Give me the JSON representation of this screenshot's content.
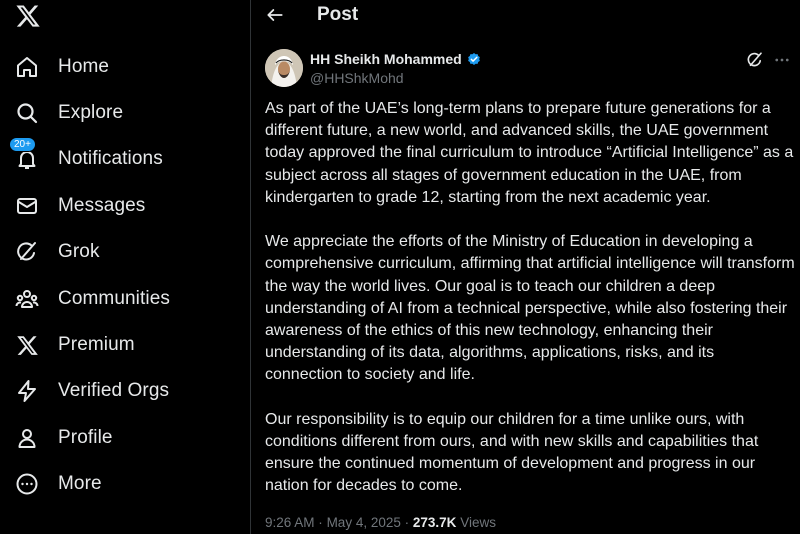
{
  "sidebar": {
    "logo": "x-logo-icon",
    "items": [
      {
        "label": "Home",
        "icon": "home-icon"
      },
      {
        "label": "Explore",
        "icon": "search-icon"
      },
      {
        "label": "Notifications",
        "icon": "bell-icon",
        "badge": "20+"
      },
      {
        "label": "Messages",
        "icon": "envelope-icon"
      },
      {
        "label": "Grok",
        "icon": "grok-icon"
      },
      {
        "label": "Communities",
        "icon": "communities-icon"
      },
      {
        "label": "Premium",
        "icon": "x-logo-icon"
      },
      {
        "label": "Verified Orgs",
        "icon": "lightning-icon"
      },
      {
        "label": "Profile",
        "icon": "person-icon"
      },
      {
        "label": "More",
        "icon": "more-circle-icon"
      }
    ]
  },
  "header": {
    "back_icon": "arrow-left-icon",
    "title": "Post"
  },
  "post": {
    "author_name": "HH Sheikh Mohammed",
    "author_handle": "@HHShkMohd",
    "verified_icon": "verified-badge-icon",
    "paragraphs": [
      "As part of the UAE’s long-term plans to prepare future generations for a different future, a new world, and advanced skills, the UAE government today approved the final curriculum to introduce “Artificial Intelligence” as a subject across all stages of government education in the UAE, from kindergarten to grade 12, starting from the next academic year.",
      "We appreciate the efforts of the Ministry of Education in developing a comprehensive curriculum, affirming that artificial intelligence will transform the way the world lives. Our goal is to teach our children a deep understanding of AI from a technical perspective, while also fostering their awareness of the ethics of this new technology, enhancing their understanding of its data, algorithms, applications, risks, and its connection to society and life.",
      "Our responsibility is to equip our children for a time unlike ours, with conditions different from ours, and with new skills and capabilities that ensure the continued momentum of development and progress in our nation for decades to come."
    ],
    "time": "9:26 AM",
    "separator": "·",
    "date": "May 4, 2025",
    "views_count": "273.7K",
    "views_label": "Views"
  },
  "colors": {
    "background": "#000000",
    "text": "#e7e9ea",
    "secondary_text": "#71767b",
    "accent": "#1d9bf0",
    "divider": "#2f3336"
  }
}
